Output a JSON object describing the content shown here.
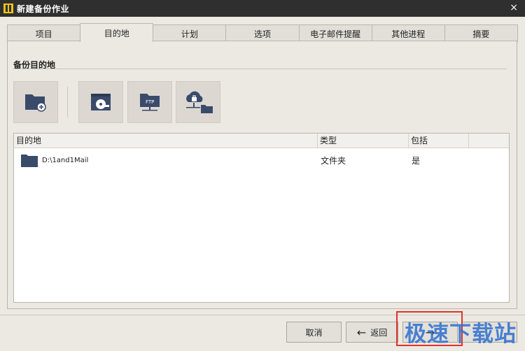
{
  "window": {
    "title": "新建备份作业",
    "close_label": "×"
  },
  "tabs": [
    {
      "label": "项目",
      "active": false
    },
    {
      "label": "目的地",
      "active": true
    },
    {
      "label": "计划",
      "active": false
    },
    {
      "label": "选项",
      "active": false
    },
    {
      "label": "电子邮件提醒",
      "active": false
    },
    {
      "label": "其他进程",
      "active": false
    },
    {
      "label": "摘要",
      "active": false
    }
  ],
  "section": {
    "title": "备份目的地"
  },
  "toolbar": {
    "buttons": [
      {
        "icon": "folder-add-icon"
      },
      {
        "icon": "disc-drive-icon"
      },
      {
        "icon": "ftp-folder-icon"
      },
      {
        "icon": "cloud-lock-icon"
      }
    ]
  },
  "table": {
    "columns": [
      "目的地",
      "类型",
      "包括"
    ],
    "rows": [
      {
        "destination": "D:\\1and1Mail",
        "type": "文件夹",
        "include": "是",
        "icon": "folder-icon"
      }
    ]
  },
  "footer": {
    "cancel_label": "取消",
    "back_label": "返回",
    "next_label": "→"
  },
  "watermark": {
    "text": "极速下载站"
  },
  "colors": {
    "titlebar": "#2f2f2f",
    "accent_highlight": "#e0332a",
    "folder": "#3a4a6b"
  }
}
